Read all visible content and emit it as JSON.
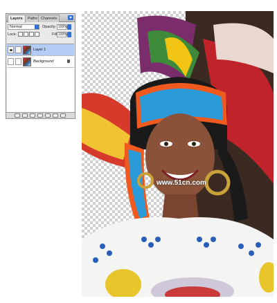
{
  "layers_panel": {
    "tabs": [
      "Layers",
      "Paths",
      "Channels"
    ],
    "blend_mode": "Normal",
    "opacity_label": "Opacity:",
    "opacity_value": "100%",
    "lock_label": "Lock:",
    "fill_label": "Fill:",
    "fill_value": "100%",
    "layers": [
      {
        "name": "Layer 1",
        "selected": true,
        "visible": true
      },
      {
        "name": "Background",
        "selected": false,
        "visible": false,
        "locked": true
      }
    ]
  },
  "watermark": "www.51cn.com",
  "colors": {
    "selection": "#b3ccf5",
    "accent_blue": "#2f6fd6",
    "headband_orange": "#f05a1e",
    "sequin_blue": "#2a9bd8"
  }
}
